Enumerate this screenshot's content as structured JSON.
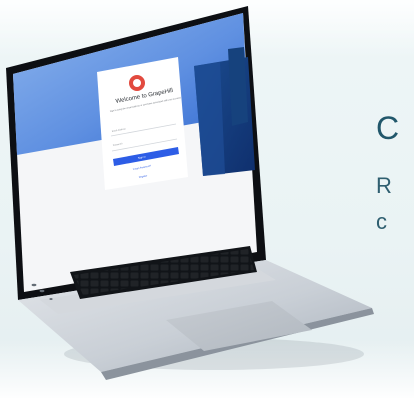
{
  "hero": {
    "heading_partial": "C",
    "copy_partial_1": "R",
    "copy_partial_2": "c"
  },
  "login": {
    "title": "Welcome to GrapeHill",
    "subtitle": "Sign in using the email address or username associated with your account.",
    "email_label": "Email Address",
    "password_label": "Password",
    "sign_in_label": "Sign in",
    "forgot_password_label": "Forgot Password?",
    "register_label": "Register"
  },
  "colors": {
    "accent": "#2d5de6",
    "logo_red": "#e24a3f",
    "hero_text": "#21576b"
  },
  "icons": {
    "logo": "grapehill-logo-icon"
  }
}
